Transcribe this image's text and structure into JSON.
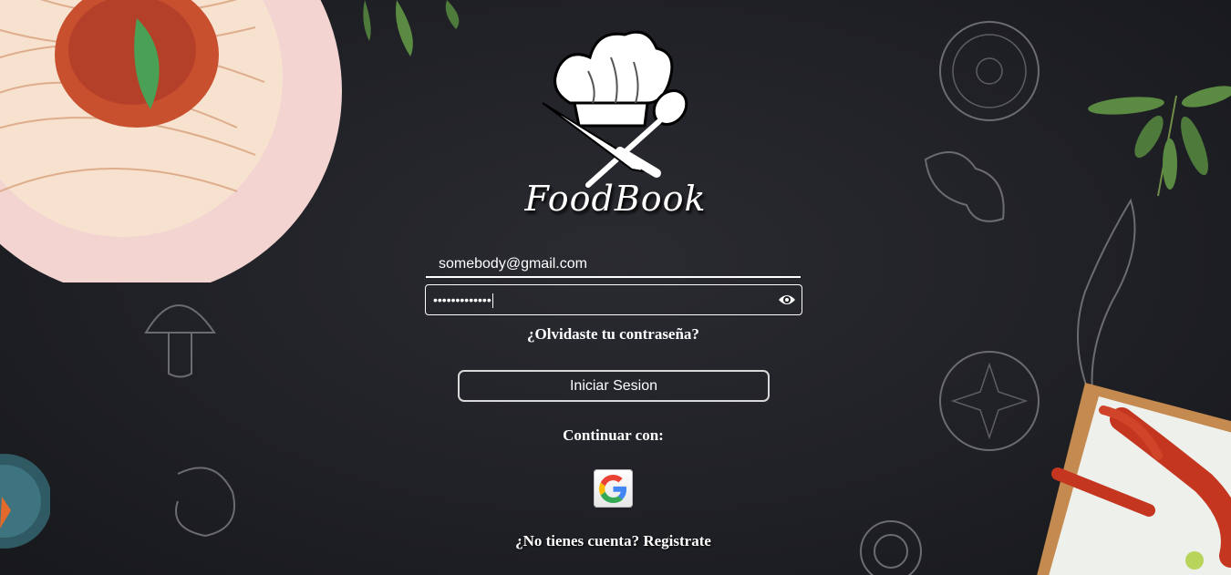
{
  "app": {
    "brand_name": "FoodBook"
  },
  "login_form": {
    "email_value": "somebody@gmail.com",
    "password_mask": "•••••••••••••",
    "forgot_password_label": "¿Olvidaste tu contraseña?",
    "submit_label": "Iniciar Sesion",
    "continue_with_label": "Continuar con:",
    "register_label": "¿No tienes cuenta? Registrate"
  },
  "icons": {
    "password_toggle": "eye-icon",
    "social_login": "google-icon",
    "logo": "chef-hat-logo"
  },
  "colors": {
    "background": "#1e1f24",
    "text": "#ffffff",
    "google_blue": "#4285F4",
    "google_red": "#EA4335",
    "google_yellow": "#FBBC05",
    "google_green": "#34A853"
  }
}
